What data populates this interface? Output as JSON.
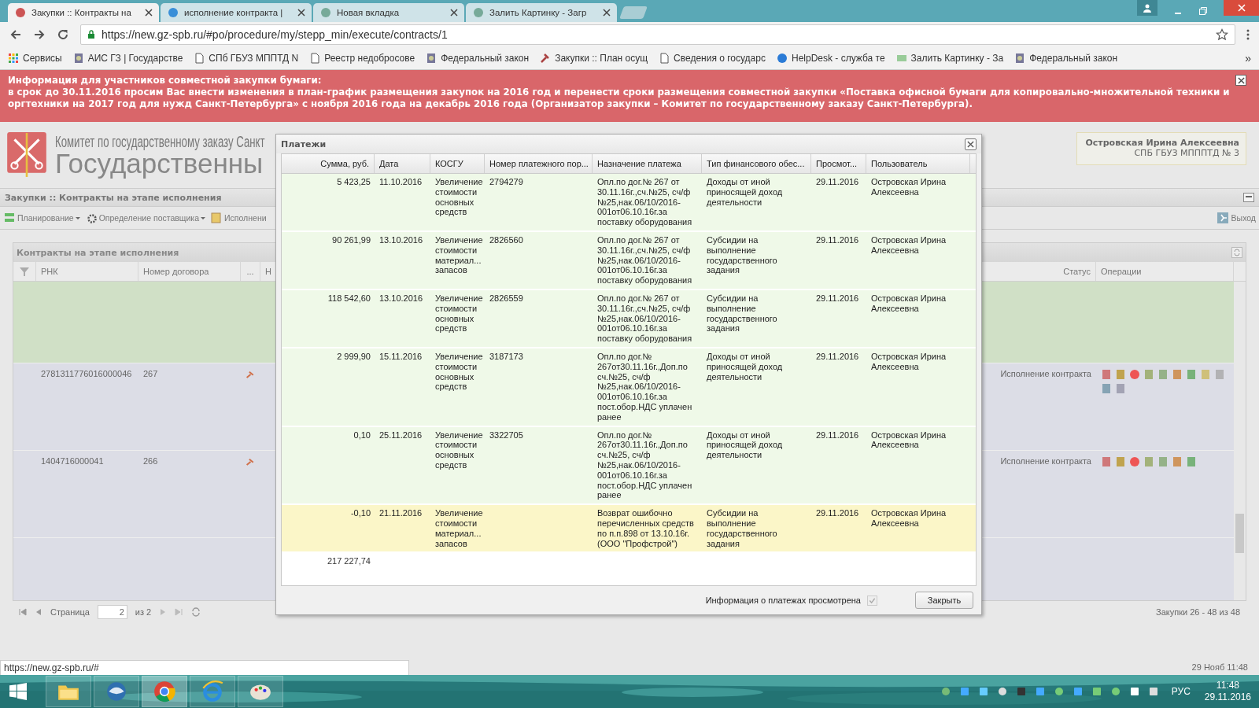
{
  "browser": {
    "tabs": [
      {
        "label": "Закупки :: Контракты на",
        "selected": true
      },
      {
        "label": "исполнение контракта |",
        "selected": false
      },
      {
        "label": "Новая вкладка",
        "selected": false
      },
      {
        "label": "Залить Картинку - Загр",
        "selected": false
      }
    ],
    "url": "https://new.gz-spb.ru/#po/procedure/my/stepp_min/execute/contracts/1",
    "bookmarks": [
      "Сервисы",
      "АИС ГЗ | Государстве",
      "СПб ГБУЗ МППТД N",
      "Реестр недобросове",
      "Федеральный закон",
      "Закупки :: План осущ",
      "Сведения о государс",
      "HelpDesk - служба те",
      "Залить Картинку - За",
      "Федеральный закон"
    ],
    "more": "»"
  },
  "notice": {
    "title": "Информация для участников совместной закупки бумаги:",
    "text": "в срок до 30.11.2016 просим Вас внести изменения в план-график размещения закупок на 2016 год и перенести сроки размещения совместной закупки «Поставка офисной бумаги для копировально-множительной техники и оргтехники на 2017 год для нужд Санкт-Петербурга» с ноября 2016 года на декабрь 2016 года (Организатор закупки – Комитет по государственному заказу Санкт-Петербурга)."
  },
  "header": {
    "org_line": "Комитет по государственному заказу Санкт",
    "title": "Государственны",
    "user": {
      "name": "Островская Ирина Алексеевна",
      "org": "СПБ ГБУЗ МПППТД № 3"
    }
  },
  "page_title": "Закупки :: Контракты на этапе исполнения",
  "menu": [
    "Планирование",
    "Определение поставщика",
    "Исполнени"
  ],
  "logout": "Выход",
  "contracts": {
    "title": "Контракты на этапе исполнения",
    "columns": [
      "РНК",
      "Номер договора",
      "...",
      "Н",
      "Статус",
      "Операции"
    ],
    "rows": [
      {
        "selected": true
      },
      {
        "selected": false,
        "rnk": "2781311776016000046",
        "number": "267",
        "status": "Исполнение контракта"
      },
      {
        "selected": false,
        "rnk": "1404716000041",
        "number": "266",
        "status": "Исполнение контракта"
      }
    ],
    "pager": {
      "page_label": "Страница",
      "page": "2",
      "of": "из 2",
      "summary": "Закупки 26 - 48 из 48"
    }
  },
  "payments": {
    "title": "Платежи",
    "columns": [
      "Сумма, руб.",
      "Дата",
      "КОСГУ",
      "Номер платежного пор...",
      "Назначение платежа",
      "Тип финансового обес...",
      "Просмот...",
      "Пользователь"
    ],
    "rows": [
      {
        "amount": "5 423,25",
        "date": "11.10.2016",
        "kosgu": "Увеличение стоимости основных средств",
        "order_no": "2794279",
        "purpose": "Опл.по дог.№ 267 от 30.11.16г.,сч.№25, сч/ф №25,нак.06/10/2016-001от06.10.16г.за поставку оборудования",
        "funding": "Доходы от иной приносящей доход деятельности",
        "viewed": "29.11.2016",
        "user": "Островская Ирина Алексеевна",
        "highlighted": false
      },
      {
        "amount": "90 261,99",
        "date": "13.10.2016",
        "kosgu": "Увеличение стоимости материал... запасов",
        "order_no": "2826560",
        "purpose": "Опл.по дог.№ 267 от 30.11.16г.,сч.№25, сч/ф №25,нак.06/10/2016-001от06.10.16г.за поставку оборудования",
        "funding": "Субсидии на выполнение государственного задания",
        "viewed": "29.11.2016",
        "user": "Островская Ирина Алексеевна",
        "highlighted": false
      },
      {
        "amount": "118 542,60",
        "date": "13.10.2016",
        "kosgu": "Увеличение стоимости основных средств",
        "order_no": "2826559",
        "purpose": "Опл.по дог.№ 267 от 30.11.16г.,сч.№25, сч/ф №25,нак.06/10/2016-001от06.10.16г.за поставку оборудования",
        "funding": "Субсидии на выполнение государственного задания",
        "viewed": "29.11.2016",
        "user": "Островская Ирина Алексеевна",
        "highlighted": false
      },
      {
        "amount": "2 999,90",
        "date": "15.11.2016",
        "kosgu": "Увеличение стоимости основных средств",
        "order_no": "3187173",
        "purpose": "Опл.по дог.№ 267от30.11.16г.,Доп.по сч.№25, сч/ф №25,нак.06/10/2016-001от06.10.16г.за пост.обор.НДС уплачен ранее",
        "funding": "Доходы от иной приносящей доход деятельности",
        "viewed": "29.11.2016",
        "user": "Островская Ирина Алексеевна",
        "highlighted": false
      },
      {
        "amount": "0,10",
        "date": "25.11.2016",
        "kosgu": "Увеличение стоимости основных средств",
        "order_no": "3322705",
        "purpose": "Опл.по дог.№ 267от30.11.16г.,Доп.по сч.№25, сч/ф №25,нак.06/10/2016-001от06.10.16г.за пост.обор.НДС уплачен ранее",
        "funding": "Доходы от иной приносящей доход деятельности",
        "viewed": "29.11.2016",
        "user": "Островская Ирина Алексеевна",
        "highlighted": false
      },
      {
        "amount": "-0,10",
        "date": "21.11.2016",
        "kosgu": "Увеличение стоимости материал... запасов",
        "purpose": "Возврат ошибочно перечисленных средств по п.п.898 от 13.10.16г. (ООО \"Профстрой\")",
        "funding": "Субсидии на выполнение государственного задания",
        "viewed": "29.11.2016",
        "user": "Островская Ирина Алексеевна",
        "highlighted": true
      }
    ],
    "total": "217 227,74",
    "viewed": {
      "label": "Информация о платежах просмотрена",
      "checked": true
    },
    "close": "Закрыть"
  },
  "status_url": "https://new.gz-spb.ru/#",
  "server_time": "29 Нояб 11:48",
  "taskbar": {
    "apps": [
      {
        "selected": false
      },
      {
        "selected": false
      },
      {
        "selected": true
      },
      {
        "selected": false
      },
      {
        "selected": false
      }
    ],
    "language": "РУС",
    "time": "11:48",
    "date": "29.11.2016"
  }
}
